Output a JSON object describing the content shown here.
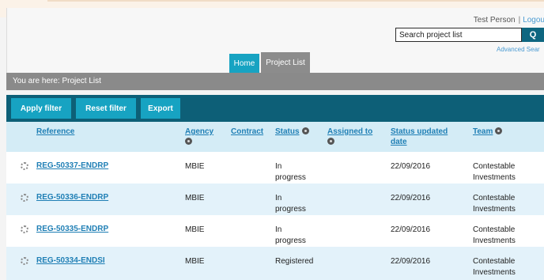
{
  "user": {
    "name": "Test Person",
    "separator": "|",
    "logout": "Logou"
  },
  "search": {
    "value": "Search project list",
    "button": "Q",
    "advanced": "Advanced Sear"
  },
  "tabs": [
    {
      "label": "Home"
    },
    {
      "label": "Project List"
    }
  ],
  "breadcrumb": "You are here: Project List",
  "toolbar": {
    "apply": "Apply filter",
    "reset": "Reset filter",
    "export": "Export"
  },
  "columns": {
    "reference": "Reference",
    "agency": "Agency",
    "contract": "Contract",
    "status": "Status",
    "assigned": "Assigned to",
    "status_updated": "Status updated date",
    "team": "Team"
  },
  "rows": [
    {
      "reference": "REG-50337-ENDRP",
      "agency": "MBIE",
      "contract": "",
      "status": "In progress",
      "assigned": "",
      "status_updated": "22/09/2016",
      "team": "Contestable Investments"
    },
    {
      "reference": "REG-50336-ENDRP",
      "agency": "MBIE",
      "contract": "",
      "status": "In progress",
      "assigned": "",
      "status_updated": "22/09/2016",
      "team": "Contestable Investments"
    },
    {
      "reference": "REG-50335-ENDRP",
      "agency": "MBIE",
      "contract": "",
      "status": "In progress",
      "assigned": "",
      "status_updated": "22/09/2016",
      "team": "Contestable Investments"
    },
    {
      "reference": "REG-50334-ENDSI",
      "agency": "MBIE",
      "contract": "",
      "status": "Registered",
      "assigned": "",
      "status_updated": "22/09/2016",
      "team": "Contestable Investments"
    }
  ],
  "colors": {
    "toolbar_bg": "#0d5f77",
    "button_bg": "#17a3c2",
    "header_bg": "#d4ecf6",
    "row_alt_bg": "#e3f2fa",
    "link": "#1f7fb5",
    "breadcrumb_bg": "#8a8a8a"
  }
}
